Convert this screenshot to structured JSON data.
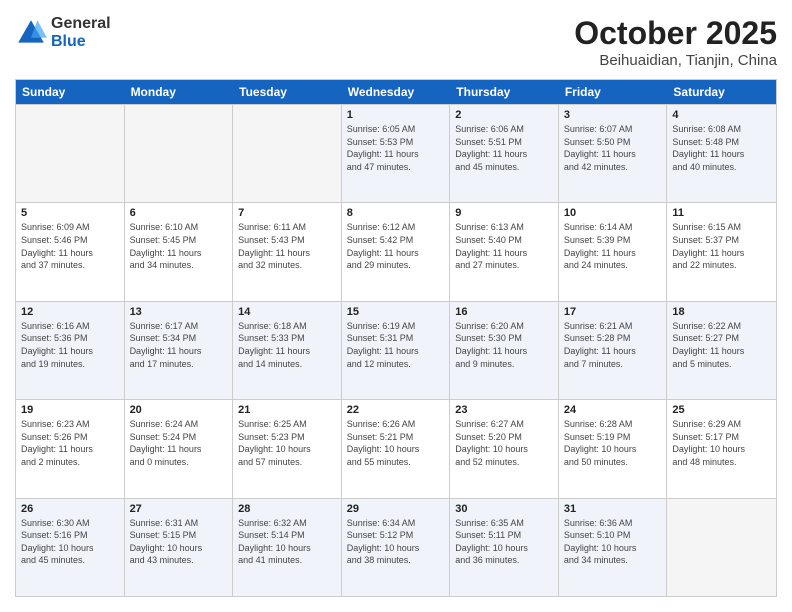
{
  "header": {
    "logo_general": "General",
    "logo_blue": "Blue",
    "month_title": "October 2025",
    "location": "Beihuaidian, Tianjin, China"
  },
  "weekdays": [
    "Sunday",
    "Monday",
    "Tuesday",
    "Wednesday",
    "Thursday",
    "Friday",
    "Saturday"
  ],
  "weeks": [
    {
      "row": 1,
      "days": [
        {
          "num": "",
          "info": "",
          "empty": true
        },
        {
          "num": "",
          "info": "",
          "empty": true
        },
        {
          "num": "",
          "info": "",
          "empty": true
        },
        {
          "num": "1",
          "info": "Sunrise: 6:05 AM\nSunset: 5:53 PM\nDaylight: 11 hours\nand 47 minutes.",
          "empty": false
        },
        {
          "num": "2",
          "info": "Sunrise: 6:06 AM\nSunset: 5:51 PM\nDaylight: 11 hours\nand 45 minutes.",
          "empty": false
        },
        {
          "num": "3",
          "info": "Sunrise: 6:07 AM\nSunset: 5:50 PM\nDaylight: 11 hours\nand 42 minutes.",
          "empty": false
        },
        {
          "num": "4",
          "info": "Sunrise: 6:08 AM\nSunset: 5:48 PM\nDaylight: 11 hours\nand 40 minutes.",
          "empty": false
        }
      ]
    },
    {
      "row": 2,
      "days": [
        {
          "num": "5",
          "info": "Sunrise: 6:09 AM\nSunset: 5:46 PM\nDaylight: 11 hours\nand 37 minutes.",
          "empty": false
        },
        {
          "num": "6",
          "info": "Sunrise: 6:10 AM\nSunset: 5:45 PM\nDaylight: 11 hours\nand 34 minutes.",
          "empty": false
        },
        {
          "num": "7",
          "info": "Sunrise: 6:11 AM\nSunset: 5:43 PM\nDaylight: 11 hours\nand 32 minutes.",
          "empty": false
        },
        {
          "num": "8",
          "info": "Sunrise: 6:12 AM\nSunset: 5:42 PM\nDaylight: 11 hours\nand 29 minutes.",
          "empty": false
        },
        {
          "num": "9",
          "info": "Sunrise: 6:13 AM\nSunset: 5:40 PM\nDaylight: 11 hours\nand 27 minutes.",
          "empty": false
        },
        {
          "num": "10",
          "info": "Sunrise: 6:14 AM\nSunset: 5:39 PM\nDaylight: 11 hours\nand 24 minutes.",
          "empty": false
        },
        {
          "num": "11",
          "info": "Sunrise: 6:15 AM\nSunset: 5:37 PM\nDaylight: 11 hours\nand 22 minutes.",
          "empty": false
        }
      ]
    },
    {
      "row": 3,
      "days": [
        {
          "num": "12",
          "info": "Sunrise: 6:16 AM\nSunset: 5:36 PM\nDaylight: 11 hours\nand 19 minutes.",
          "empty": false
        },
        {
          "num": "13",
          "info": "Sunrise: 6:17 AM\nSunset: 5:34 PM\nDaylight: 11 hours\nand 17 minutes.",
          "empty": false
        },
        {
          "num": "14",
          "info": "Sunrise: 6:18 AM\nSunset: 5:33 PM\nDaylight: 11 hours\nand 14 minutes.",
          "empty": false
        },
        {
          "num": "15",
          "info": "Sunrise: 6:19 AM\nSunset: 5:31 PM\nDaylight: 11 hours\nand 12 minutes.",
          "empty": false
        },
        {
          "num": "16",
          "info": "Sunrise: 6:20 AM\nSunset: 5:30 PM\nDaylight: 11 hours\nand 9 minutes.",
          "empty": false
        },
        {
          "num": "17",
          "info": "Sunrise: 6:21 AM\nSunset: 5:28 PM\nDaylight: 11 hours\nand 7 minutes.",
          "empty": false
        },
        {
          "num": "18",
          "info": "Sunrise: 6:22 AM\nSunset: 5:27 PM\nDaylight: 11 hours\nand 5 minutes.",
          "empty": false
        }
      ]
    },
    {
      "row": 4,
      "days": [
        {
          "num": "19",
          "info": "Sunrise: 6:23 AM\nSunset: 5:26 PM\nDaylight: 11 hours\nand 2 minutes.",
          "empty": false
        },
        {
          "num": "20",
          "info": "Sunrise: 6:24 AM\nSunset: 5:24 PM\nDaylight: 11 hours\nand 0 minutes.",
          "empty": false
        },
        {
          "num": "21",
          "info": "Sunrise: 6:25 AM\nSunset: 5:23 PM\nDaylight: 10 hours\nand 57 minutes.",
          "empty": false
        },
        {
          "num": "22",
          "info": "Sunrise: 6:26 AM\nSunset: 5:21 PM\nDaylight: 10 hours\nand 55 minutes.",
          "empty": false
        },
        {
          "num": "23",
          "info": "Sunrise: 6:27 AM\nSunset: 5:20 PM\nDaylight: 10 hours\nand 52 minutes.",
          "empty": false
        },
        {
          "num": "24",
          "info": "Sunrise: 6:28 AM\nSunset: 5:19 PM\nDaylight: 10 hours\nand 50 minutes.",
          "empty": false
        },
        {
          "num": "25",
          "info": "Sunrise: 6:29 AM\nSunset: 5:17 PM\nDaylight: 10 hours\nand 48 minutes.",
          "empty": false
        }
      ]
    },
    {
      "row": 5,
      "days": [
        {
          "num": "26",
          "info": "Sunrise: 6:30 AM\nSunset: 5:16 PM\nDaylight: 10 hours\nand 45 minutes.",
          "empty": false
        },
        {
          "num": "27",
          "info": "Sunrise: 6:31 AM\nSunset: 5:15 PM\nDaylight: 10 hours\nand 43 minutes.",
          "empty": false
        },
        {
          "num": "28",
          "info": "Sunrise: 6:32 AM\nSunset: 5:14 PM\nDaylight: 10 hours\nand 41 minutes.",
          "empty": false
        },
        {
          "num": "29",
          "info": "Sunrise: 6:34 AM\nSunset: 5:12 PM\nDaylight: 10 hours\nand 38 minutes.",
          "empty": false
        },
        {
          "num": "30",
          "info": "Sunrise: 6:35 AM\nSunset: 5:11 PM\nDaylight: 10 hours\nand 36 minutes.",
          "empty": false
        },
        {
          "num": "31",
          "info": "Sunrise: 6:36 AM\nSunset: 5:10 PM\nDaylight: 10 hours\nand 34 minutes.",
          "empty": false
        },
        {
          "num": "",
          "info": "",
          "empty": true
        }
      ]
    }
  ]
}
